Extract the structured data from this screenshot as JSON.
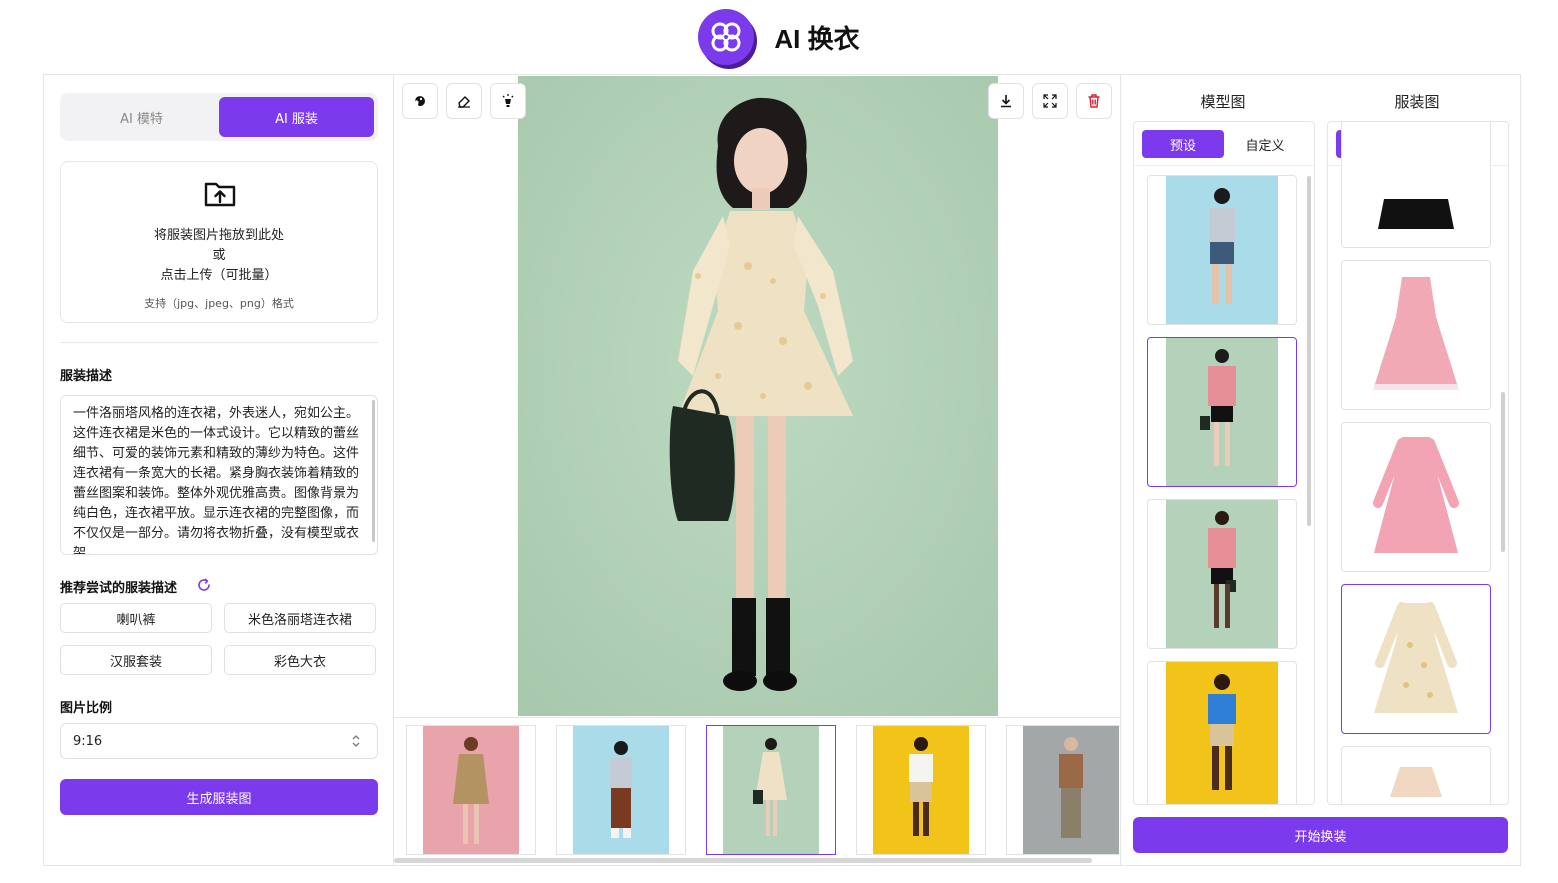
{
  "header": {
    "title": "AI 换衣"
  },
  "left": {
    "tabs": [
      {
        "label": "AI 模特"
      },
      {
        "label": "AI 服装"
      }
    ],
    "upload": {
      "line1": "将服装图片拖放到此处",
      "line2": "或",
      "line3": "点击上传（可批量）",
      "hint": "支持（jpg、jpeg、png）格式"
    },
    "description_label": "服装描述",
    "description_text": "一件洛丽塔风格的连衣裙，外表迷人，宛如公主。这件连衣裙是米色的一体式设计。它以精致的蕾丝细节、可爱的装饰元素和精致的薄纱为特色。这件连衣裙有一条宽大的长裙。紧身胸衣装饰着精致的蕾丝图案和装饰。整体外观优雅高贵。图像背景为纯白色，连衣裙平放。显示连衣裙的完整图像，而不仅仅是一部分。请勿将衣物折叠，没有模型或衣架。",
    "suggest_label": "推荐尝试的服装描述",
    "suggestions": [
      "喇叭裤",
      "米色洛丽塔连衣裙",
      "汉服套装",
      "彩色大衣"
    ],
    "ratio_label": "图片比例",
    "ratio_value": "9:16",
    "generate_button": "生成服装图"
  },
  "right": {
    "model_title": "模型图",
    "clothing_title": "服装图",
    "tab_preset": "预设",
    "tab_custom": "自定义",
    "start_button": "开始换装"
  },
  "colors": {
    "accent": "#7c3aed",
    "photo_bg_green": "#b4d2b9"
  },
  "icons": [
    "logo-icon",
    "upload-folder-icon",
    "refresh-icon",
    "select-caret-icon",
    "palette-icon",
    "eraser-icon",
    "bulb-icon",
    "download-icon",
    "fullscreen-icon",
    "delete-icon"
  ]
}
